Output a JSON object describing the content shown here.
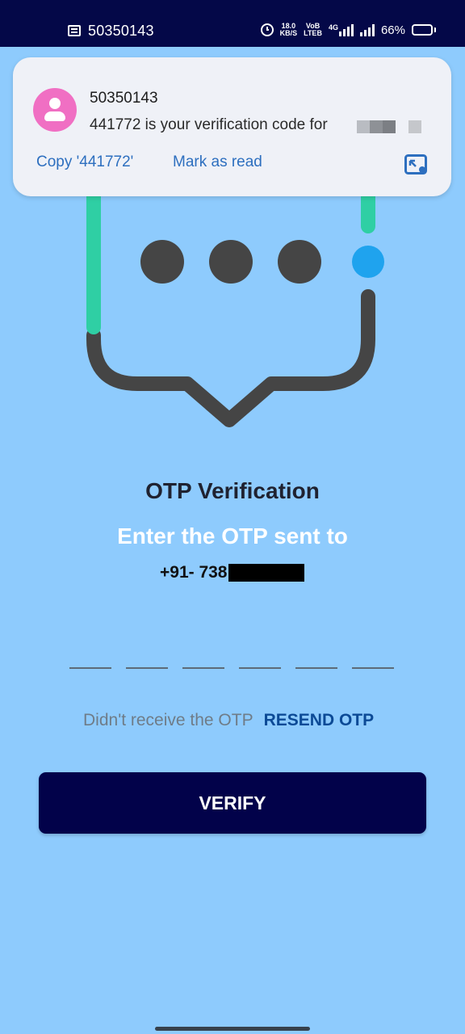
{
  "status_bar": {
    "notification_sender": "50350143",
    "speed_value": "18.0",
    "speed_unit": "KB/S",
    "volte_top": "VoB",
    "volte_bottom": "LTEB",
    "network": "4G",
    "battery": "66%",
    "icons": [
      "message-icon",
      "alarm-icon",
      "signal-icon",
      "battery-icon"
    ]
  },
  "notification": {
    "sender": "50350143",
    "body": "441772 is your verification code for",
    "copy_action": "Copy '441772'",
    "mark_read_action": "Mark as read",
    "icons": [
      "avatar-icon",
      "expand-icon"
    ]
  },
  "main": {
    "title": "OTP Verification",
    "subtitle": "Enter the OTP sent to",
    "phone_visible": "+91- 738",
    "otp_slots": 6,
    "resend_question": "Didn't receive the OTP",
    "resend_link": "RESEND OTP",
    "verify_button": "VERIFY"
  },
  "colors": {
    "background": "#8ECBFD",
    "status_bar": "#040848",
    "button": "#02024A",
    "accent_green": "#2FCFA4",
    "accent_blue": "#1FA3EE",
    "dark_gray": "#454545",
    "link_blue": "#0C4A96"
  }
}
